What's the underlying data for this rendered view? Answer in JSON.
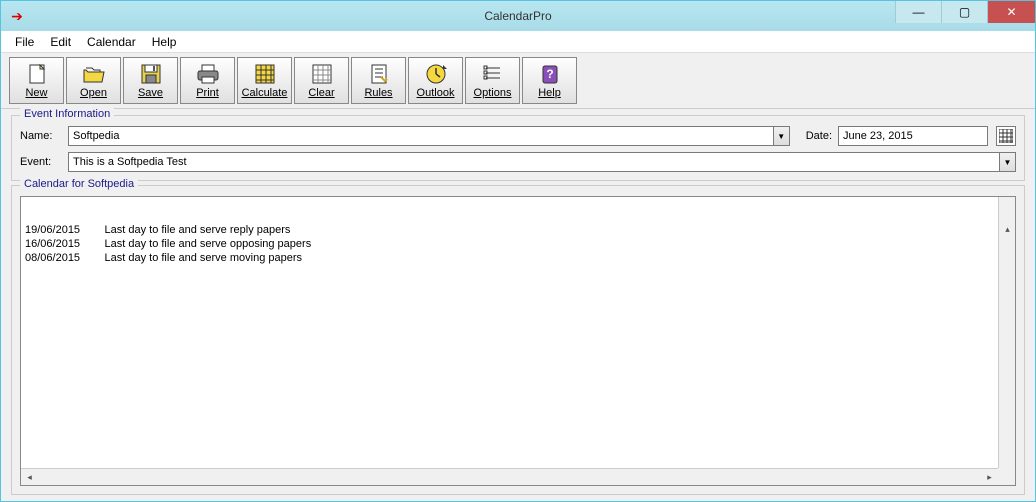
{
  "window": {
    "title": "CalendarPro"
  },
  "controls": {
    "minimize": "—",
    "maximize": "▢",
    "close": "✕"
  },
  "menu": [
    "File",
    "Edit",
    "Calendar",
    "Help"
  ],
  "toolbar": [
    {
      "label": "New",
      "icon": "new"
    },
    {
      "label": "Open",
      "icon": "open"
    },
    {
      "label": "Save",
      "icon": "save"
    },
    {
      "label": "Print",
      "icon": "print"
    },
    {
      "label": "Calculate",
      "icon": "calc"
    },
    {
      "label": "Clear",
      "icon": "clear"
    },
    {
      "label": "Rules",
      "icon": "rules"
    },
    {
      "label": "Outlook",
      "icon": "outlook"
    },
    {
      "label": "Options",
      "icon": "options"
    },
    {
      "label": "Help",
      "icon": "help"
    }
  ],
  "eventInfo": {
    "legend": "Event Information",
    "nameLabel": "Name:",
    "nameValue": "Softpedia",
    "dateLabel": "Date:",
    "dateValue": "June 23, 2015",
    "eventLabel": "Event:",
    "eventValue": "This is a Softpedia Test"
  },
  "calendar": {
    "legend": "Calendar for Softpedia",
    "rows": [
      {
        "date": "19/06/2015",
        "desc": "Last day to file and serve reply papers"
      },
      {
        "date": "16/06/2015",
        "desc": "Last day to file and serve opposing papers"
      },
      {
        "date": "08/06/2015",
        "desc": "Last day to file and serve moving papers"
      }
    ]
  }
}
